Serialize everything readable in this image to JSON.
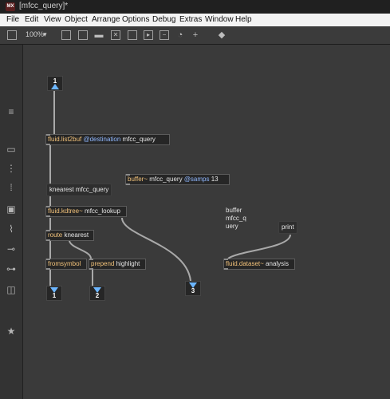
{
  "window": {
    "title": "[mfcc_query]*"
  },
  "menu": [
    "File",
    "Edit",
    "View",
    "Object",
    "Arrange",
    "Options",
    "Debug",
    "Extras",
    "Window",
    "Help"
  ],
  "toolbar": {
    "zoom": "100%"
  },
  "objects": {
    "list2buf": {
      "name": "fluid.list2buf",
      "attr": "@destination",
      "arg": "mfcc_query"
    },
    "buffer": {
      "name": "buffer~",
      "arg": "mfcc_query",
      "attr": "@samps",
      "val": "13"
    },
    "kdtree": {
      "name": "fluid.kdtree~",
      "arg": "mfcc_lookup"
    },
    "route": {
      "name": "route",
      "arg": "knearest"
    },
    "fromsymbol": {
      "name": "fromsymbol"
    },
    "prepend": {
      "name": "prepend",
      "arg": "highlight"
    },
    "dataset": {
      "name": "fluid.dataset~",
      "arg": "analysis"
    }
  },
  "messages": {
    "knearest": "knearest mfcc_query",
    "print": "print"
  },
  "comment": "buffer\nmfcc_q\nuery",
  "ports": {
    "inlet1": "1",
    "outlet1": "1",
    "outlet2": "2",
    "outlet3": "3"
  }
}
